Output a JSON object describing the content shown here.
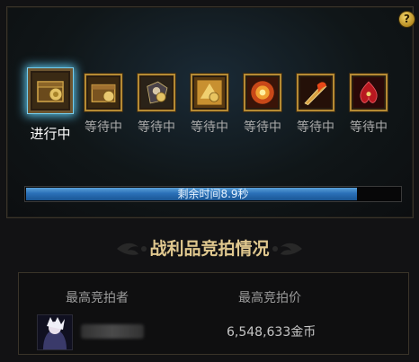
{
  "help": {
    "label": "?"
  },
  "auction_slots": [
    {
      "status": "进行中",
      "icon": "reward-box-icon",
      "active": true
    },
    {
      "status": "等待中",
      "icon": "reward-box-icon",
      "active": false
    },
    {
      "status": "等待中",
      "icon": "gauntlet-icon",
      "active": false
    },
    {
      "status": "等待中",
      "icon": "golden-item-icon",
      "active": false
    },
    {
      "status": "等待中",
      "icon": "fire-orb-icon",
      "active": false
    },
    {
      "status": "等待中",
      "icon": "flame-blade-icon",
      "active": false
    },
    {
      "status": "等待中",
      "icon": "crimson-crest-icon",
      "active": false
    }
  ],
  "timer": {
    "label": "剩余时间8.9秒",
    "fill_fraction": 0.885
  },
  "auction": {
    "title": "战利品竞拍情况",
    "highest_bidder_header": "最高竞拍者",
    "highest_bid_header": "最高竞拍价",
    "highest_bid_value": "6,548,633金币"
  },
  "colors": {
    "accent_gold": "#e0c88f",
    "active_glow": "#5bc3e8",
    "progress_blue": "#2a70b8"
  }
}
